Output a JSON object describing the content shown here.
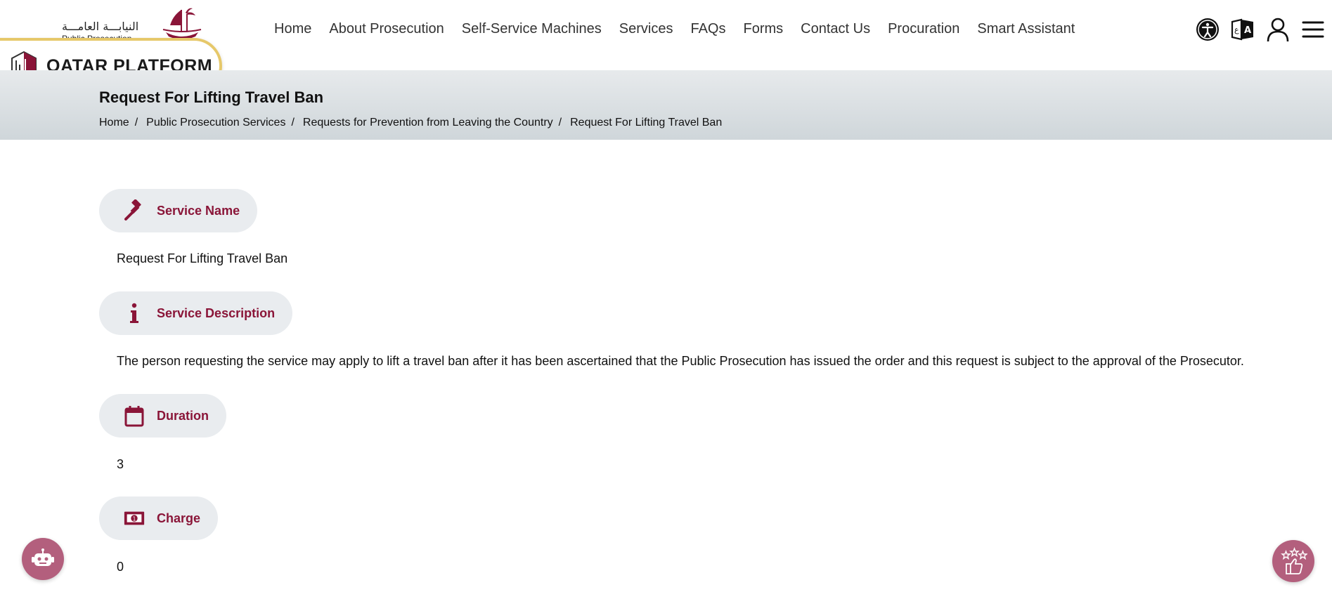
{
  "header": {
    "logo_arabic": "النيابـــة العامـــة",
    "logo_english": "Public Prosecution",
    "nav": [
      "Home",
      "About Prosecution",
      "Self-Service Machines",
      "Services",
      "FAQs",
      "Forms",
      "Contact Us",
      "Procuration",
      "Smart Assistant"
    ],
    "icons": [
      "accessibility-icon",
      "language-icon",
      "user-icon",
      "menu-icon"
    ]
  },
  "badge": {
    "text": "QATAR PLATFORM"
  },
  "banner": {
    "title": "Request For Lifting Travel Ban",
    "breadcrumb": [
      "Home",
      "Public Prosecution Services",
      "Requests for Prevention from Leaving the Country",
      "Request For Lifting Travel Ban"
    ]
  },
  "sections": {
    "service_name": {
      "label": "Service Name",
      "value": "Request For Lifting Travel Ban"
    },
    "service_description": {
      "label": "Service Description",
      "value": "The person requesting the service may apply to lift a travel ban after it has been ascertained that the Public Prosecution has issued the order and this request is subject to the approval of the Prosecutor."
    },
    "duration": {
      "label": "Duration",
      "value": "3"
    },
    "charge": {
      "label": "Charge",
      "value": "0"
    }
  },
  "colors": {
    "accent": "#8a1538",
    "pill_bg": "#e9ecef",
    "float_btn": "#b35f7d",
    "badge_border": "#e6c86a"
  }
}
